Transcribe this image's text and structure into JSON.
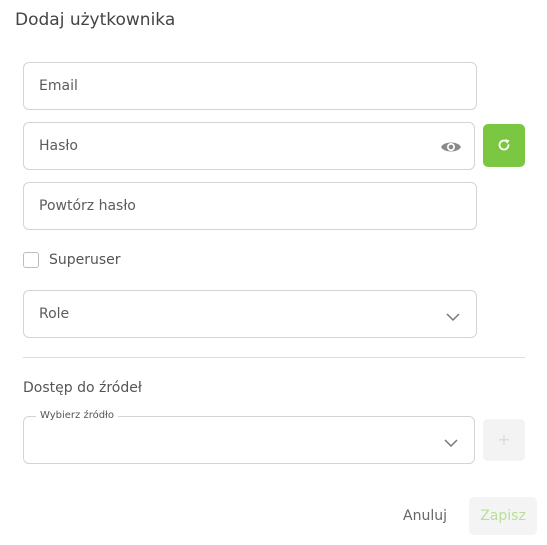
{
  "dialog": {
    "title": "Dodaj użytkownika"
  },
  "form": {
    "email_placeholder": "Email",
    "password_placeholder": "Hasło",
    "repeat_password_placeholder": "Powtórz hasło",
    "superuser_label": "Superuser",
    "superuser_checked": false,
    "role_placeholder": "Role"
  },
  "sources": {
    "section_label": "Dostęp do źródeł",
    "select_label": "Wybierz źródło",
    "selected_value": ""
  },
  "footer": {
    "cancel_label": "Anuluj",
    "save_label": "Zapisz"
  },
  "colors": {
    "accent": "#7cc741",
    "save_disabled_text": "#b9df97"
  },
  "icons": {
    "password_visibility": "eye-icon",
    "generate_password": "refresh-icon",
    "dropdown": "chevron-down-icon"
  }
}
